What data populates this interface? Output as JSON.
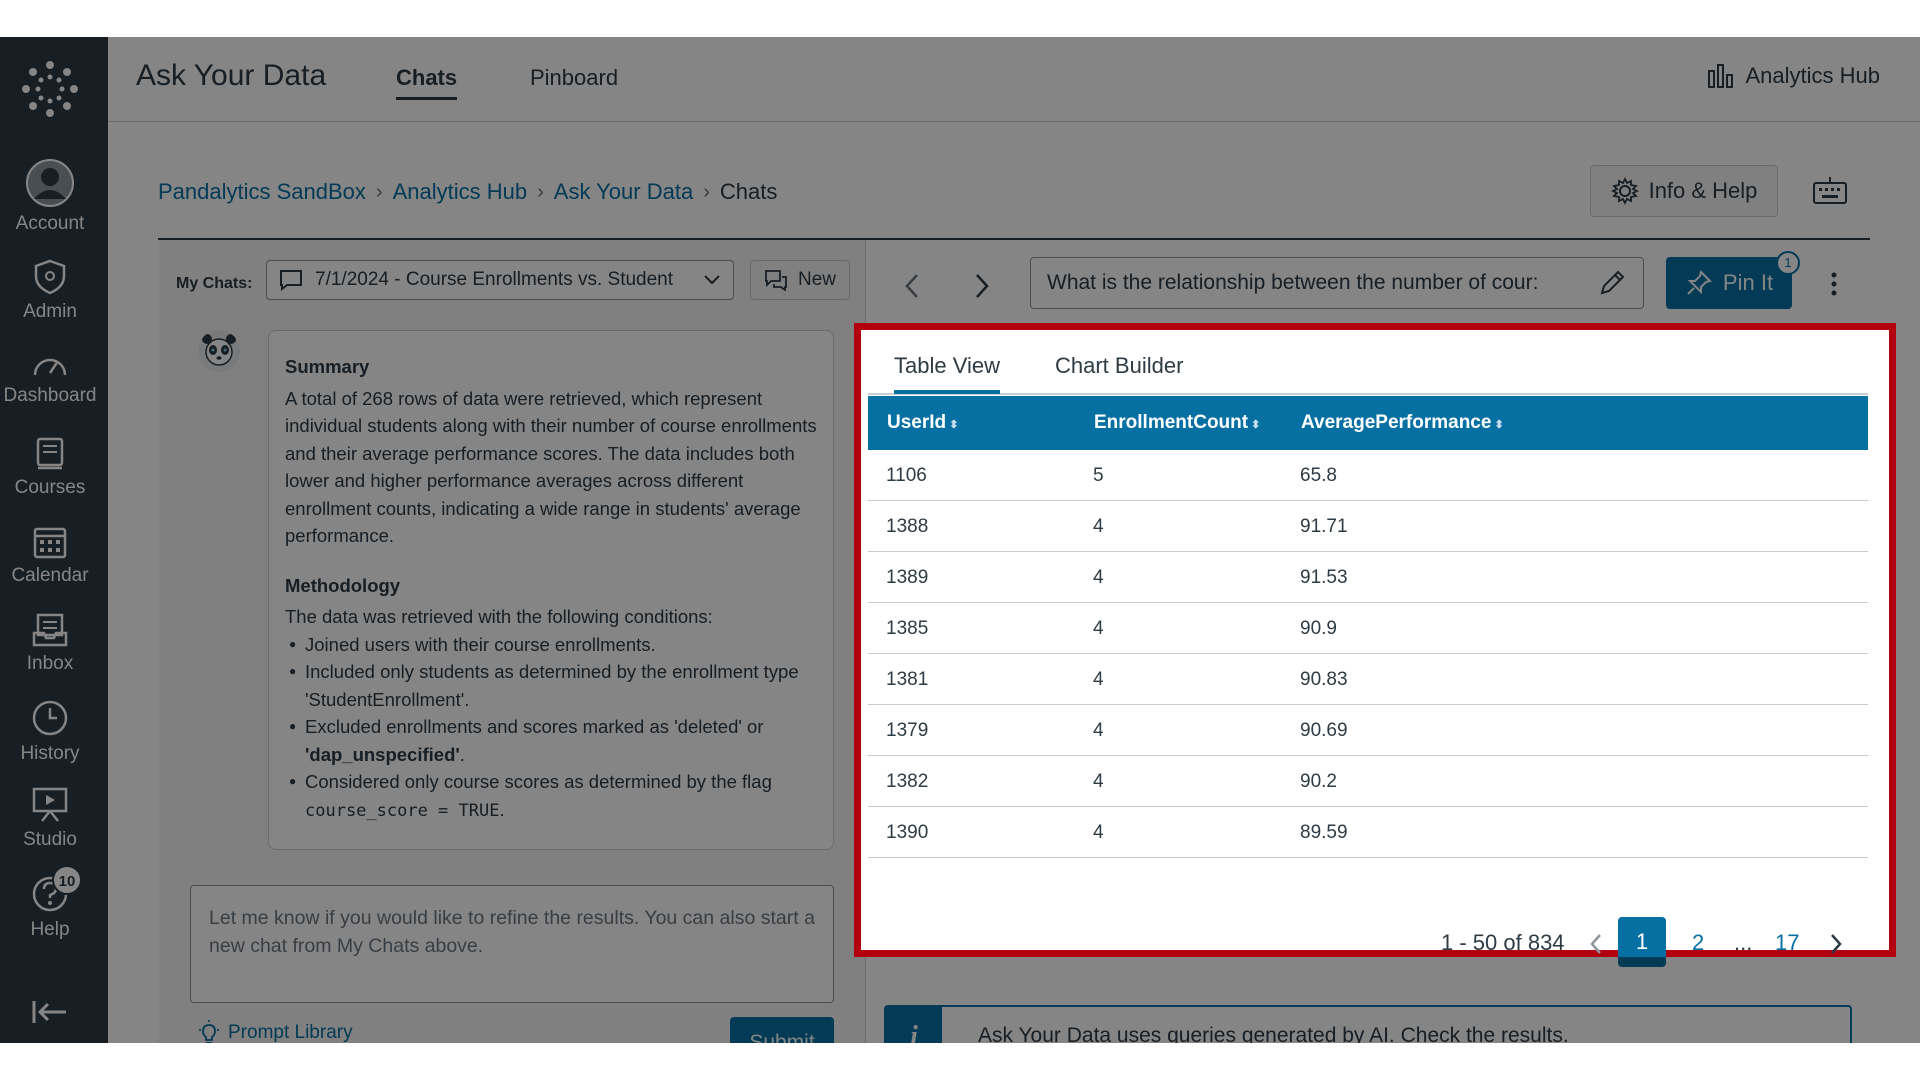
{
  "global_nav": {
    "items": [
      {
        "label": "Account",
        "icon": "account-icon"
      },
      {
        "label": "Admin",
        "icon": "admin-shield-icon"
      },
      {
        "label": "Dashboard",
        "icon": "dashboard-icon"
      },
      {
        "label": "Courses",
        "icon": "courses-icon"
      },
      {
        "label": "Calendar",
        "icon": "calendar-icon"
      },
      {
        "label": "Inbox",
        "icon": "inbox-icon"
      },
      {
        "label": "History",
        "icon": "history-clock-icon"
      },
      {
        "label": "Studio",
        "icon": "studio-icon"
      },
      {
        "label": "Help",
        "icon": "help-icon",
        "badge": "10"
      }
    ]
  },
  "header": {
    "title": "Ask Your Data",
    "tabs": [
      {
        "label": "Chats",
        "active": true
      },
      {
        "label": "Pinboard",
        "active": false
      }
    ],
    "analytics_hub": "Analytics Hub"
  },
  "breadcrumb": {
    "items": [
      "Pandalytics SandBox",
      "Analytics Hub",
      "Ask Your Data"
    ],
    "current": "Chats"
  },
  "info_help": "Info & Help",
  "chat_panel": {
    "my_chats_label": "My Chats:",
    "selected_chat": "7/1/2024 - Course Enrollments vs. Student",
    "new_label": "New",
    "message": {
      "summary_heading": "Summary",
      "summary_text": "A total of 268 rows of data were retrieved, which represent individual students along with their number of course enrollments and their average performance scores. The data includes both lower and higher performance averages across different enrollment counts, indicating a wide range in students' average performance.",
      "methodology_heading": "Methodology",
      "methodology_intro": "The data was retrieved with the following conditions:",
      "bullet_1": "Joined users with their course enrollments.",
      "bullet_2": "Included only students as determined by the enrollment type 'StudentEnrollment'.",
      "bullet_3_a": "Excluded enrollments and scores marked as 'deleted' or",
      "bullet_3_b": "'dap_unspecified'",
      "bullet_3_c": ".",
      "bullet_4_a": "Considered only course scores as determined by the flag",
      "bullet_4_code": "course_score = TRUE",
      "bullet_4_c": "."
    },
    "prompt_placeholder": "Let me know if you would like to refine the results.  You can also start a new chat from My Chats above.",
    "prompt_library": "Prompt Library",
    "submit": "Submit"
  },
  "results_panel": {
    "question": "What is the relationship between the number of cour:",
    "pin_label": "Pin It",
    "pin_count": "1",
    "tabs": [
      {
        "label": "Table View",
        "active": true
      },
      {
        "label": "Chart Builder",
        "active": false
      }
    ],
    "columns": [
      "UserId",
      "EnrollmentCount",
      "AveragePerformance"
    ],
    "rows": [
      [
        "1106",
        "5",
        "65.8"
      ],
      [
        "1388",
        "4",
        "91.71"
      ],
      [
        "1389",
        "4",
        "91.53"
      ],
      [
        "1385",
        "4",
        "90.9"
      ],
      [
        "1381",
        "4",
        "90.83"
      ],
      [
        "1379",
        "4",
        "90.69"
      ],
      [
        "1382",
        "4",
        "90.2"
      ],
      [
        "1390",
        "4",
        "89.59"
      ]
    ],
    "pagination": {
      "range": "1 - 50 of 834",
      "current": "1",
      "next": "2",
      "ellipsis": "...",
      "last": "17"
    },
    "notice_icon": "i",
    "notice": "Ask Your Data uses queries generated by AI. Check the results."
  },
  "colors": {
    "nav_bg": "#2d3b45",
    "brand_blue": "#0770a3",
    "highlight_red": "#b3000f"
  }
}
